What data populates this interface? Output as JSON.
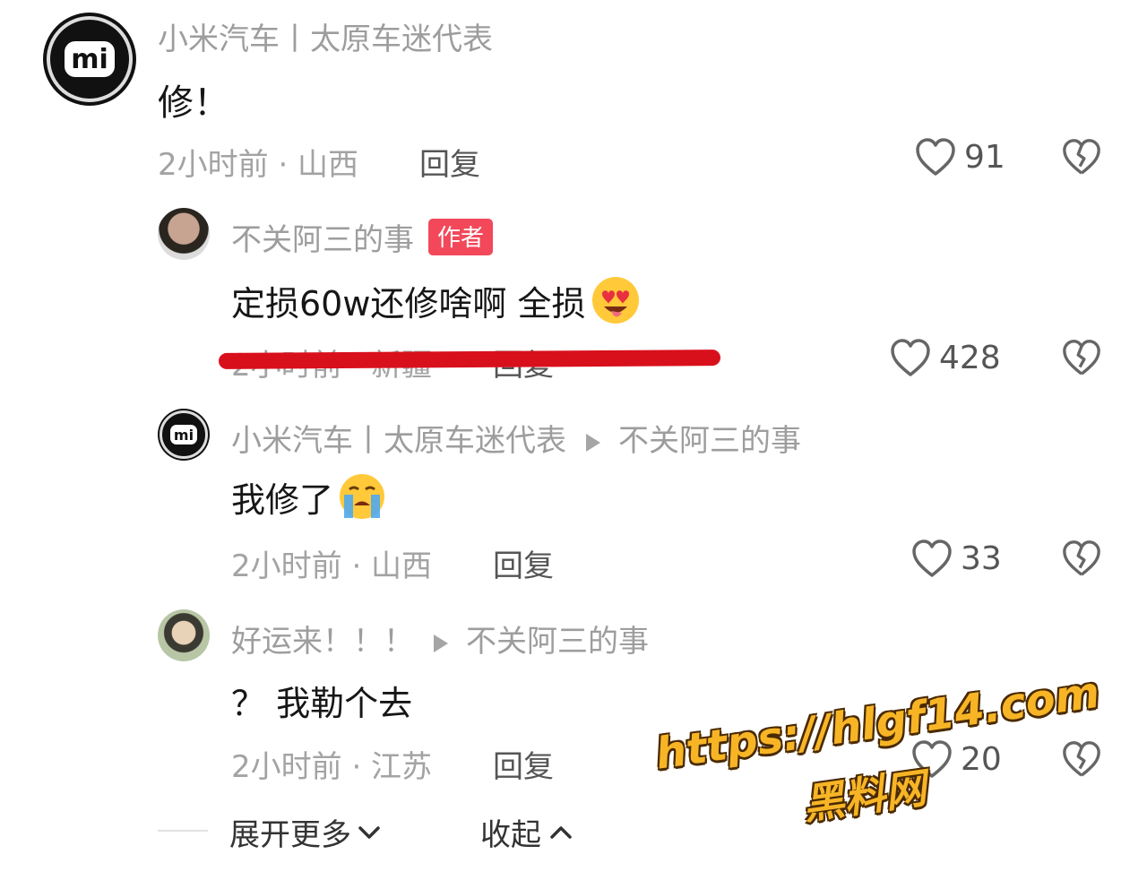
{
  "comments": [
    {
      "username": "小米汽车丨太原车迷代表",
      "text": "修！",
      "time_location": "2小时前 · 山西",
      "reply_label": "回复",
      "likes": "91"
    },
    {
      "username": "不关阿三的事",
      "author_tag": "作者",
      "text": "定损60w还修啥啊 全损",
      "emoji": "heart-eyes-tongue-emoji",
      "time_location": "2小时前 · 新疆",
      "reply_label": "回复",
      "likes": "428"
    },
    {
      "username": "小米汽车丨太原车迷代表",
      "reply_to": "不关阿三的事",
      "text": "我修了",
      "emoji": "crying-emoji",
      "time_location": "2小时前 · 山西",
      "reply_label": "回复",
      "likes": "33"
    },
    {
      "username": "好运来！！！",
      "reply_to": "不关阿三的事",
      "text": "？ 我勒个去",
      "time_location": "2小时前 · 江苏",
      "reply_label": "回复",
      "likes": "20"
    }
  ],
  "footer": {
    "expand_more": "展开更多",
    "collapse": "收起"
  },
  "watermark": {
    "url": "https://hlgf14.com",
    "name": "黑料网"
  },
  "colors": {
    "author_tag": "#f2485a",
    "strike_line": "#d8101c",
    "watermark": "#f7b526"
  }
}
